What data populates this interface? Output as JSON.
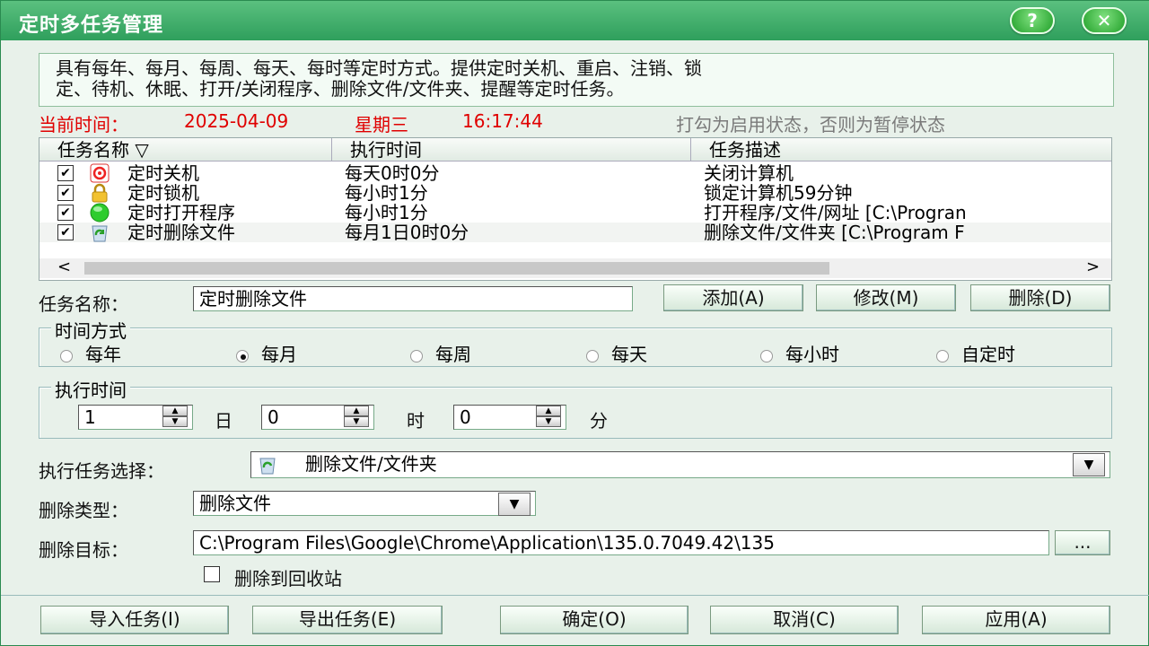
{
  "window": {
    "title": "定时多任务管理",
    "help_label": "?",
    "close_label": "✕"
  },
  "info": {
    "line1": "具有每年、每月、每周、每天、每时等定时方式。提供定时关机、重启、注销、锁",
    "line2": "定、待机、休眠、打开/关闭程序、删除文件/文件夹、提醒等定时任务。"
  },
  "status": {
    "current_time_label": "当前时间：",
    "date": "2025-04-09",
    "weekday": "星期三",
    "time": "16:17:44",
    "hint": "打勾为启用状态，否则为暂停状态"
  },
  "task_list": {
    "columns": [
      "任务名称 ▽",
      "执行时间",
      "任务描述"
    ],
    "rows": [
      {
        "checked": true,
        "icon": "shutdown-icon",
        "name": "定时关机",
        "schedule": "每天0时0分",
        "desc": "关闭计算机"
      },
      {
        "checked": true,
        "icon": "lock-icon",
        "name": "定时锁机",
        "schedule": "每小时1分",
        "desc": "锁定计算机59分钟"
      },
      {
        "checked": true,
        "icon": "green-circle-icon",
        "name": "定时打开程序",
        "schedule": "每小时1分",
        "desc": "打开程序/文件/网址 [C:\\Progran"
      },
      {
        "checked": true,
        "icon": "recycle-icon",
        "name": "定时删除文件",
        "schedule": "每月1日0时0分",
        "desc": "删除文件/文件夹 [C:\\Program F"
      }
    ],
    "scroll_left": "<",
    "scroll_right": ">"
  },
  "form": {
    "task_name_label": "任务名称：",
    "task_name_value": "定时删除文件",
    "add_label": "添加(A)",
    "modify_label": "修改(M)",
    "delete_label": "删除(D)",
    "time_mode_title": "时间方式",
    "time_modes": [
      "每年",
      "每月",
      "每周",
      "每天",
      "每小时",
      "自定时"
    ],
    "selected_time_mode": "每月",
    "exec_time_title": "执行时间",
    "day_value": "1",
    "day_unit": "日",
    "hour_value": "0",
    "hour_unit": "时",
    "minute_value": "0",
    "minute_unit": "分",
    "exec_task_label": "执行任务选择：",
    "exec_task_value": "删除文件/文件夹",
    "delete_type_label": "删除类型：",
    "delete_type_value": "删除文件",
    "delete_target_label": "删除目标：",
    "delete_target_value": "C:\\Program Files\\Google\\Chrome\\Application\\135.0.7049.42\\135",
    "browse_label": "...",
    "recycle_label": "删除到回收站",
    "recycle_checked": false
  },
  "footer": {
    "import_label": "导入任务(I)",
    "export_label": "导出任务(E)",
    "ok_label": "确定(O)",
    "cancel_label": "取消(C)",
    "apply_label": "应用(A)"
  }
}
